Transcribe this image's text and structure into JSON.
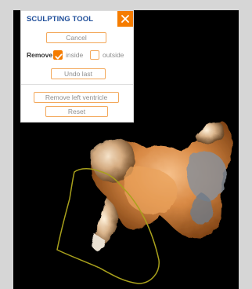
{
  "panel": {
    "title": "SCULPTING TOOL",
    "close_icon": "close-icon",
    "cancel_label": "Cancel",
    "remove_label": "Remove",
    "inside_label": "inside",
    "inside_checked": true,
    "outside_label": "outside",
    "outside_checked": false,
    "undo_label": "Undo last",
    "remove_lv_label": "Remove left ventricle",
    "reset_label": "Reset"
  },
  "colors": {
    "accent": "#f57c00",
    "title": "#1f4e9a",
    "viewport_bg": "#000000",
    "lasso": "#a9a11c"
  }
}
